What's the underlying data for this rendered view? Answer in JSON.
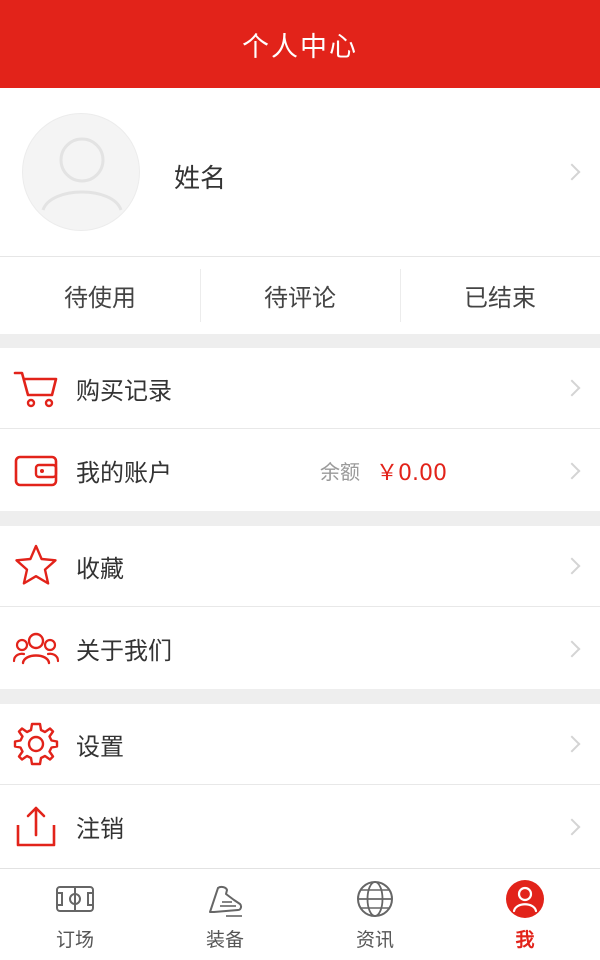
{
  "header": {
    "title": "个人中心"
  },
  "profile": {
    "name": "姓名",
    "avatar_icon": "avatar-placeholder-icon"
  },
  "order_tabs": [
    {
      "label": "待使用"
    },
    {
      "label": "待评论"
    },
    {
      "label": "已结束"
    }
  ],
  "menu": {
    "purchase": {
      "label": "购买记录",
      "icon": "cart-icon"
    },
    "account": {
      "label": "我的账户",
      "icon": "wallet-icon",
      "balance_label": "余额",
      "balance_value": "￥0.00"
    },
    "favorites": {
      "label": "收藏",
      "icon": "star-icon"
    },
    "about": {
      "label": "关于我们",
      "icon": "people-icon"
    },
    "settings": {
      "label": "设置",
      "icon": "gear-icon"
    },
    "logout": {
      "label": "注销",
      "icon": "share-upload-icon"
    }
  },
  "tabbar": [
    {
      "label": "订场",
      "icon": "court-icon",
      "active": false
    },
    {
      "label": "装备",
      "icon": "shoe-icon",
      "active": false
    },
    {
      "label": "资讯",
      "icon": "globe-icon",
      "active": false
    },
    {
      "label": "我",
      "icon": "user-icon",
      "active": true
    }
  ],
  "colors": {
    "brand": "#e2231a",
    "separator": "#eeeeee",
    "text": "#333333",
    "muted": "#9a9a9a"
  }
}
